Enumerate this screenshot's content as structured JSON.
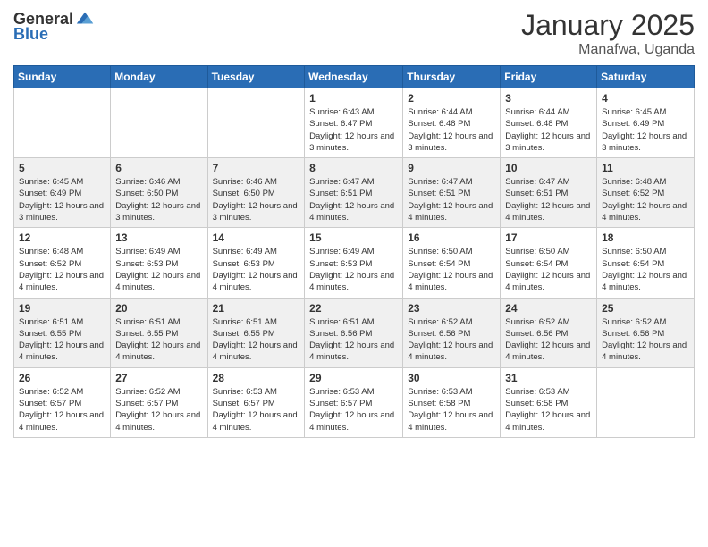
{
  "logo": {
    "general": "General",
    "blue": "Blue"
  },
  "title": {
    "month": "January 2025",
    "location": "Manafwa, Uganda"
  },
  "days_of_week": [
    "Sunday",
    "Monday",
    "Tuesday",
    "Wednesday",
    "Thursday",
    "Friday",
    "Saturday"
  ],
  "weeks": [
    [
      {
        "day": "",
        "info": ""
      },
      {
        "day": "",
        "info": ""
      },
      {
        "day": "",
        "info": ""
      },
      {
        "day": "1",
        "info": "Sunrise: 6:43 AM\nSunset: 6:47 PM\nDaylight: 12 hours and 3 minutes."
      },
      {
        "day": "2",
        "info": "Sunrise: 6:44 AM\nSunset: 6:48 PM\nDaylight: 12 hours and 3 minutes."
      },
      {
        "day": "3",
        "info": "Sunrise: 6:44 AM\nSunset: 6:48 PM\nDaylight: 12 hours and 3 minutes."
      },
      {
        "day": "4",
        "info": "Sunrise: 6:45 AM\nSunset: 6:49 PM\nDaylight: 12 hours and 3 minutes."
      }
    ],
    [
      {
        "day": "5",
        "info": "Sunrise: 6:45 AM\nSunset: 6:49 PM\nDaylight: 12 hours and 3 minutes."
      },
      {
        "day": "6",
        "info": "Sunrise: 6:46 AM\nSunset: 6:50 PM\nDaylight: 12 hours and 3 minutes."
      },
      {
        "day": "7",
        "info": "Sunrise: 6:46 AM\nSunset: 6:50 PM\nDaylight: 12 hours and 3 minutes."
      },
      {
        "day": "8",
        "info": "Sunrise: 6:47 AM\nSunset: 6:51 PM\nDaylight: 12 hours and 4 minutes."
      },
      {
        "day": "9",
        "info": "Sunrise: 6:47 AM\nSunset: 6:51 PM\nDaylight: 12 hours and 4 minutes."
      },
      {
        "day": "10",
        "info": "Sunrise: 6:47 AM\nSunset: 6:51 PM\nDaylight: 12 hours and 4 minutes."
      },
      {
        "day": "11",
        "info": "Sunrise: 6:48 AM\nSunset: 6:52 PM\nDaylight: 12 hours and 4 minutes."
      }
    ],
    [
      {
        "day": "12",
        "info": "Sunrise: 6:48 AM\nSunset: 6:52 PM\nDaylight: 12 hours and 4 minutes."
      },
      {
        "day": "13",
        "info": "Sunrise: 6:49 AM\nSunset: 6:53 PM\nDaylight: 12 hours and 4 minutes."
      },
      {
        "day": "14",
        "info": "Sunrise: 6:49 AM\nSunset: 6:53 PM\nDaylight: 12 hours and 4 minutes."
      },
      {
        "day": "15",
        "info": "Sunrise: 6:49 AM\nSunset: 6:53 PM\nDaylight: 12 hours and 4 minutes."
      },
      {
        "day": "16",
        "info": "Sunrise: 6:50 AM\nSunset: 6:54 PM\nDaylight: 12 hours and 4 minutes."
      },
      {
        "day": "17",
        "info": "Sunrise: 6:50 AM\nSunset: 6:54 PM\nDaylight: 12 hours and 4 minutes."
      },
      {
        "day": "18",
        "info": "Sunrise: 6:50 AM\nSunset: 6:54 PM\nDaylight: 12 hours and 4 minutes."
      }
    ],
    [
      {
        "day": "19",
        "info": "Sunrise: 6:51 AM\nSunset: 6:55 PM\nDaylight: 12 hours and 4 minutes."
      },
      {
        "day": "20",
        "info": "Sunrise: 6:51 AM\nSunset: 6:55 PM\nDaylight: 12 hours and 4 minutes."
      },
      {
        "day": "21",
        "info": "Sunrise: 6:51 AM\nSunset: 6:55 PM\nDaylight: 12 hours and 4 minutes."
      },
      {
        "day": "22",
        "info": "Sunrise: 6:51 AM\nSunset: 6:56 PM\nDaylight: 12 hours and 4 minutes."
      },
      {
        "day": "23",
        "info": "Sunrise: 6:52 AM\nSunset: 6:56 PM\nDaylight: 12 hours and 4 minutes."
      },
      {
        "day": "24",
        "info": "Sunrise: 6:52 AM\nSunset: 6:56 PM\nDaylight: 12 hours and 4 minutes."
      },
      {
        "day": "25",
        "info": "Sunrise: 6:52 AM\nSunset: 6:56 PM\nDaylight: 12 hours and 4 minutes."
      }
    ],
    [
      {
        "day": "26",
        "info": "Sunrise: 6:52 AM\nSunset: 6:57 PM\nDaylight: 12 hours and 4 minutes."
      },
      {
        "day": "27",
        "info": "Sunrise: 6:52 AM\nSunset: 6:57 PM\nDaylight: 12 hours and 4 minutes."
      },
      {
        "day": "28",
        "info": "Sunrise: 6:53 AM\nSunset: 6:57 PM\nDaylight: 12 hours and 4 minutes."
      },
      {
        "day": "29",
        "info": "Sunrise: 6:53 AM\nSunset: 6:57 PM\nDaylight: 12 hours and 4 minutes."
      },
      {
        "day": "30",
        "info": "Sunrise: 6:53 AM\nSunset: 6:58 PM\nDaylight: 12 hours and 4 minutes."
      },
      {
        "day": "31",
        "info": "Sunrise: 6:53 AM\nSunset: 6:58 PM\nDaylight: 12 hours and 4 minutes."
      },
      {
        "day": "",
        "info": ""
      }
    ]
  ]
}
